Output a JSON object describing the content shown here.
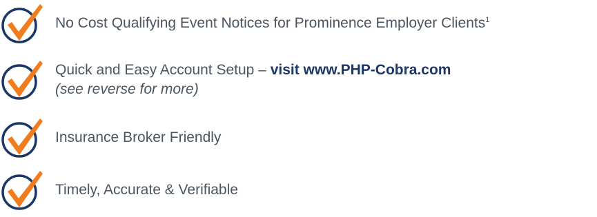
{
  "colors": {
    "text": "#4a5560",
    "navy": "#1b3766",
    "orange": "#f07c1e"
  },
  "icon": "check-circle-icon",
  "items": [
    {
      "text": "No Cost Qualifying Event Notices for Prominence Employer Clients",
      "footnote": "1"
    },
    {
      "text": "Quick and Easy Account Setup – ",
      "link": "visit www.PHP-Cobra.com",
      "note": "(see reverse for more)"
    },
    {
      "text": "Insurance Broker Friendly"
    },
    {
      "text": "Timely, Accurate & Verifiable"
    }
  ]
}
